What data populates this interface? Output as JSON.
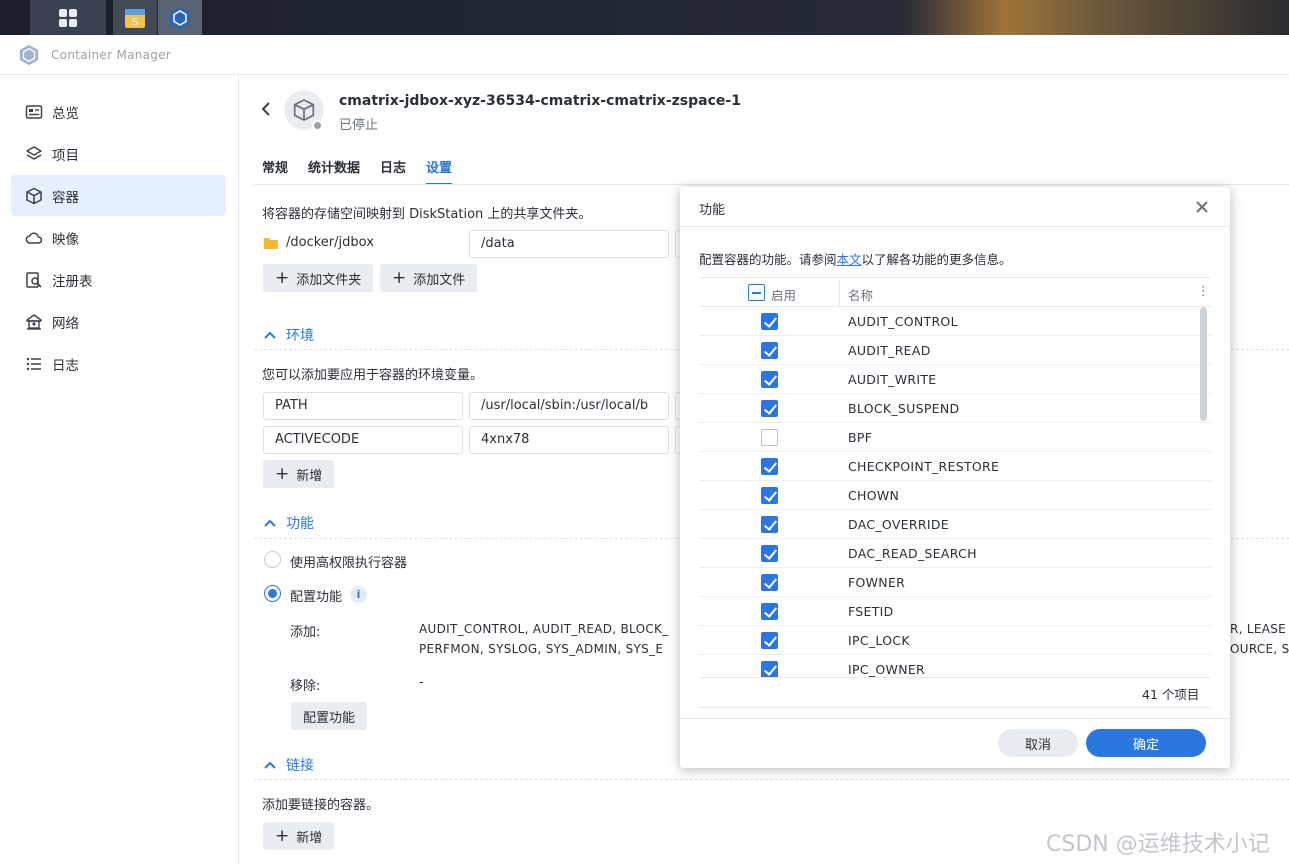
{
  "app": {
    "title": "Container Manager"
  },
  "sidebar": {
    "items": [
      {
        "label": "总览",
        "icon": "dashboard-icon"
      },
      {
        "label": "项目",
        "icon": "layers-icon"
      },
      {
        "label": "容器",
        "icon": "cube-icon",
        "active": true
      },
      {
        "label": "映像",
        "icon": "cloud-icon"
      },
      {
        "label": "注册表",
        "icon": "registry-search-icon"
      },
      {
        "label": "网络",
        "icon": "network-house-icon"
      },
      {
        "label": "日志",
        "icon": "list-icon"
      }
    ]
  },
  "container": {
    "name": "cmatrix-jdbox-xyz-36534-cmatrix-cmatrix-zspace-1",
    "status": "已停止"
  },
  "tabs": [
    "常规",
    "统计数据",
    "日志",
    "设置"
  ],
  "volumes": {
    "desc": "将容器的存储空间映射到 DiskStation 上的共享文件夹。",
    "folder": "/docker/jdbox",
    "mount": "/data",
    "add_folder": "添加文件夹",
    "add_file": "添加文件"
  },
  "env": {
    "title": "环境",
    "desc": "您可以添加要应用于容器的环境变量。",
    "rows": [
      {
        "key": "PATH",
        "value": "/usr/local/sbin:/usr/local/b"
      },
      {
        "key": "ACTIVECODE",
        "value": "4xnx78"
      }
    ],
    "add": "新增"
  },
  "caps": {
    "title": "功能",
    "opt_privileged": "使用高权限执行容器",
    "opt_configure": "配置功能",
    "info": "i",
    "add_label": "添加:",
    "add_line1_left": "AUDIT_CONTROL, AUDIT_READ, BLOCK_",
    "add_line1_right": "R, LEASE",
    "add_line2_left": "PERFMON, SYSLOG, SYS_ADMIN, SYS_E",
    "add_line2_right": "OURCE, S",
    "remove_label": "移除:",
    "remove_value": "-",
    "configure_btn": "配置功能"
  },
  "links": {
    "title": "链接",
    "desc": "添加要链接的容器。",
    "add": "新增"
  },
  "dialog": {
    "title": "功能",
    "close": "×",
    "desc_before": "配置容器的功能。请参阅",
    "desc_link": "本文",
    "desc_after": "以了解各功能的更多信息。",
    "col_enable": "启用",
    "col_name": "名称",
    "col_menu": "⋮",
    "rows": [
      {
        "name": "AUDIT_CONTROL",
        "enabled": true
      },
      {
        "name": "AUDIT_READ",
        "enabled": true
      },
      {
        "name": "AUDIT_WRITE",
        "enabled": true
      },
      {
        "name": "BLOCK_SUSPEND",
        "enabled": true
      },
      {
        "name": "BPF",
        "enabled": false
      },
      {
        "name": "CHECKPOINT_RESTORE",
        "enabled": true
      },
      {
        "name": "CHOWN",
        "enabled": true
      },
      {
        "name": "DAC_OVERRIDE",
        "enabled": true
      },
      {
        "name": "DAC_READ_SEARCH",
        "enabled": true
      },
      {
        "name": "FOWNER",
        "enabled": true
      },
      {
        "name": "FSETID",
        "enabled": true
      },
      {
        "name": "IPC_LOCK",
        "enabled": true
      },
      {
        "name": "IPC_OWNER",
        "enabled": true
      }
    ],
    "count": "41 个项目",
    "cancel": "取消",
    "ok": "确定"
  },
  "watermark": "CSDN @运维技术小记",
  "colors": {
    "accent": "#2b77e0",
    "sidebar_active_bg": "#e6efff"
  }
}
